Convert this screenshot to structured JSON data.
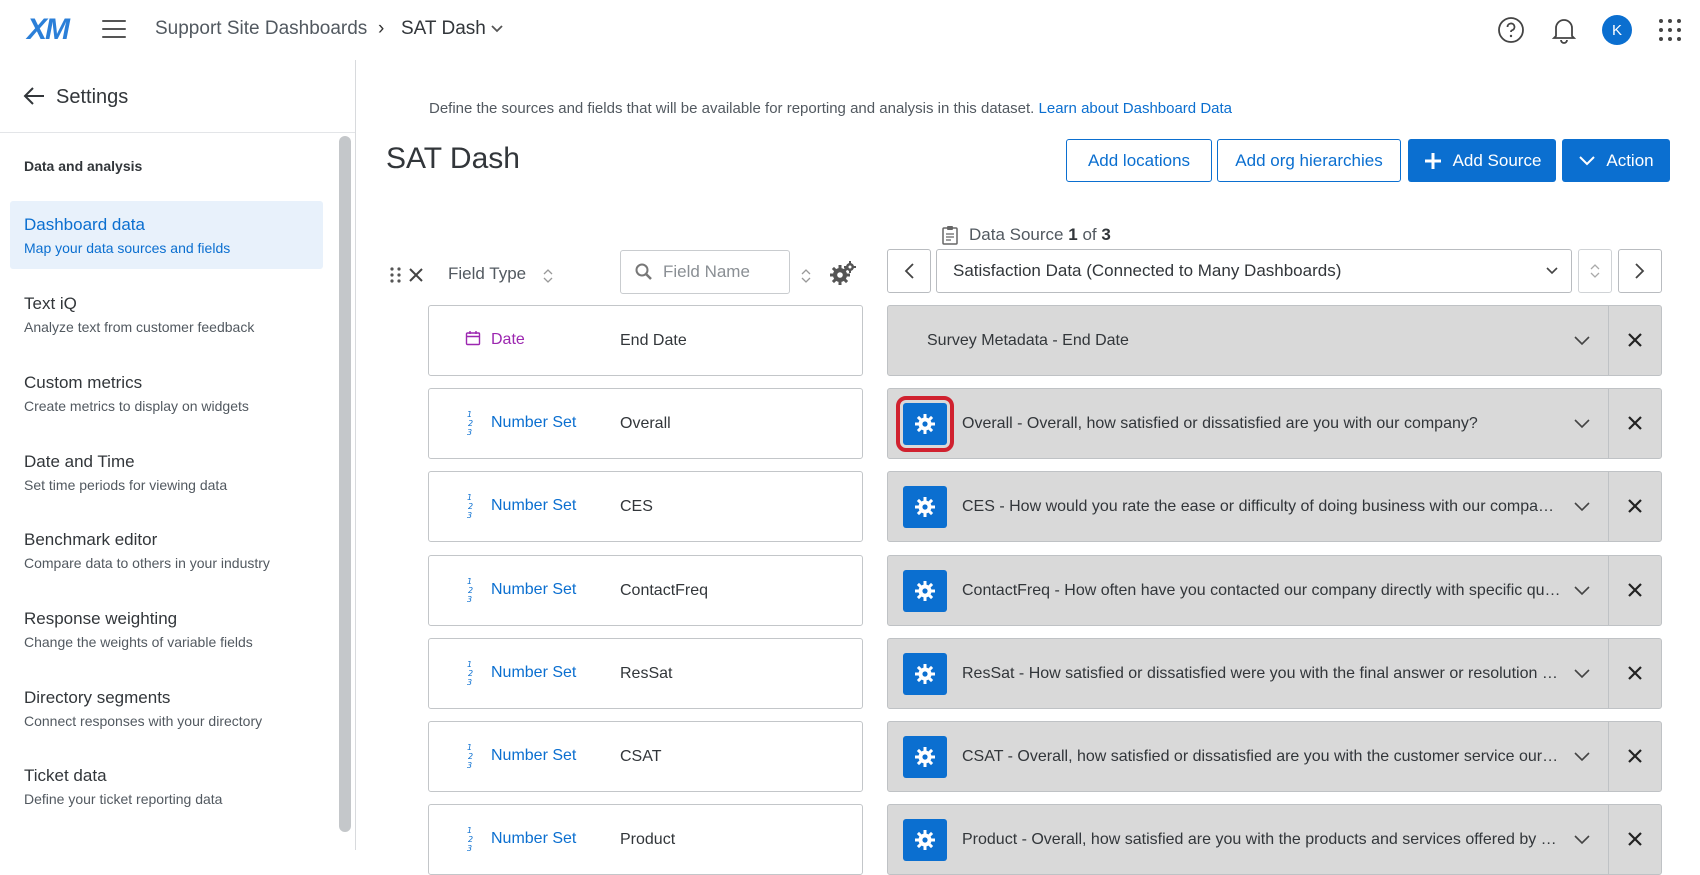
{
  "app": {
    "logo": "XM",
    "breadcrumb": [
      "Support Site Dashboards",
      "SAT Dash"
    ],
    "breadcrumb_sep": "›",
    "avatar_initial": "K",
    "accent": "#0b6fd0"
  },
  "sidebar": {
    "title": "Settings",
    "section": "Data and analysis",
    "items": [
      {
        "title": "Dashboard data",
        "desc": "Map your data sources and fields"
      },
      {
        "title": "Text iQ",
        "desc": "Analyze text from customer feedback"
      },
      {
        "title": "Custom metrics",
        "desc": "Create metrics to display on widgets"
      },
      {
        "title": "Date and Time",
        "desc": "Set time periods for viewing data"
      },
      {
        "title": "Benchmark editor",
        "desc": "Compare data to others in your industry"
      },
      {
        "title": "Response weighting",
        "desc": "Change the weights of variable fields"
      },
      {
        "title": "Directory segments",
        "desc": "Connect responses with your directory"
      },
      {
        "title": "Ticket data",
        "desc": "Define your ticket reporting data"
      }
    ]
  },
  "main": {
    "description": "Define the sources and fields that will be available for reporting and analysis in this dataset.",
    "learn_link": "Learn about Dashboard Data",
    "title": "SAT Dash",
    "buttons": {
      "add_locations": "Add locations",
      "add_org_hierarchies": "Add org hierarchies",
      "add_source": "Add Source",
      "action": "Action"
    },
    "data_source": {
      "prefix": "Data Source",
      "current": "1",
      "of": "of",
      "total": "3"
    },
    "selected_source": "Satisfaction Data (Connected to Many Dashboards)",
    "field_type_header": "Field Type",
    "search_placeholder": "Field Name"
  },
  "fields": [
    {
      "type": "Date",
      "name": "End Date",
      "mapping": "Survey Metadata - End Date"
    },
    {
      "type": "Number Set",
      "name": "Overall",
      "mapping": "Overall - Overall, how satisfied or dissatisfied are you with our company?"
    },
    {
      "type": "Number Set",
      "name": "CES",
      "mapping": "CES - How would you rate the ease or difficulty of doing business with our company?"
    },
    {
      "type": "Number Set",
      "name": "ContactFreq",
      "mapping": "ContactFreq - How often have you contacted our company directly with specific questions?"
    },
    {
      "type": "Number Set",
      "name": "ResSat",
      "mapping": "ResSat - How satisfied or dissatisfied were you with the final answer or resolution to your question?"
    },
    {
      "type": "Number Set",
      "name": "CSAT",
      "mapping": "CSAT - Overall, how satisfied or dissatisfied are you with the customer service our company provides?"
    },
    {
      "type": "Number Set",
      "name": "Product",
      "mapping": "Product - Overall, how satisfied are you with the products and services offered by our company?"
    }
  ]
}
